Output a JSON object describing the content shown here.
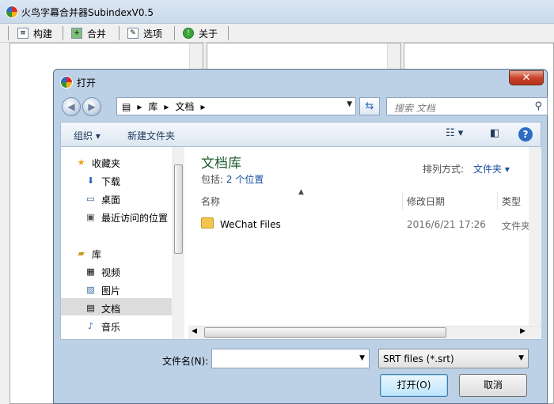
{
  "app": {
    "title": "火鸟字幕合并器SubindexV0.5",
    "toolbar": [
      {
        "label": "构建",
        "icon": "document-icon"
      },
      {
        "label": "合并",
        "icon": "merge-icon"
      },
      {
        "label": "选项",
        "icon": "options-icon"
      },
      {
        "label": "关于",
        "icon": "info-icon"
      }
    ]
  },
  "dialog": {
    "title": "打开",
    "close_label": "✕",
    "breadcrumb": [
      "库",
      "文档"
    ],
    "search_placeholder": "搜索 文档",
    "toolbar": {
      "organize": "组织 ▾",
      "new_folder": "新建文件夹",
      "help": "?"
    },
    "nav": {
      "favorites": {
        "label": "收藏夹",
        "items": [
          "下载",
          "桌面",
          "最近访问的位置"
        ]
      },
      "libraries": {
        "label": "库",
        "items": [
          "视频",
          "图片",
          "文档",
          "音乐"
        ],
        "selected": "文档"
      }
    },
    "library": {
      "title": "文档库",
      "includes_label": "包括:",
      "includes_value": "2 个位置",
      "arrange_label": "排列方式:",
      "arrange_value": "文件夹 ▾"
    },
    "columns": [
      "名称",
      "修改日期",
      "类型"
    ],
    "rows": [
      {
        "name": "WeChat Files",
        "modified": "2016/6/21 17:26",
        "type": "文件夹"
      }
    ],
    "filename_label": "文件名(N):",
    "filename_value": "",
    "filter_value": "SRT files (*.srt)",
    "open_button": "打开(O)",
    "cancel_button": "取消"
  },
  "colors": {
    "library_title": "#1e5d2c",
    "link": "#1a4f9e",
    "close": "#c8432a"
  }
}
